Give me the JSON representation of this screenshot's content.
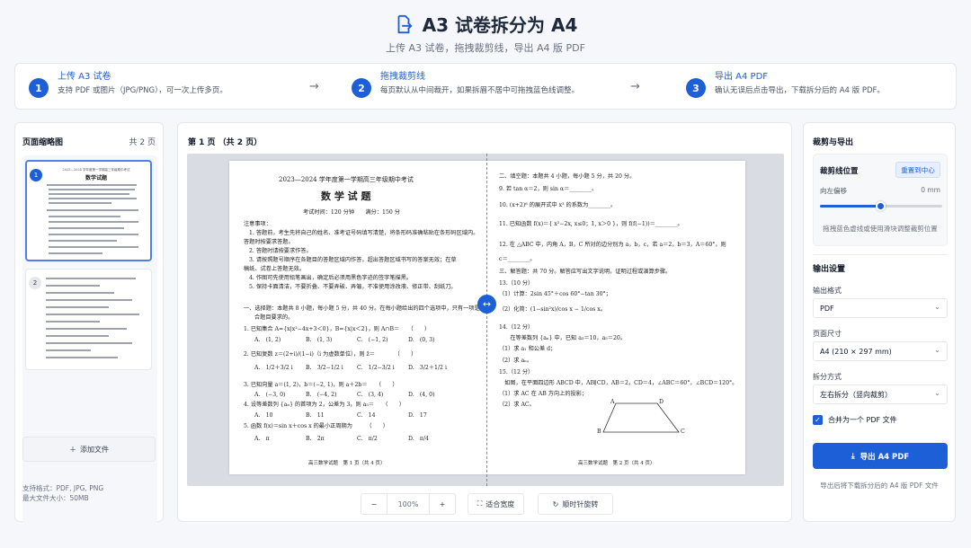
{
  "app": {
    "title": "A3 试卷拆分为 A4",
    "subtitle": "上传 A3 试卷，拖拽裁剪线，导出 A4 版 PDF",
    "icon": "file-export-icon",
    "accent": "#1d5fd6"
  },
  "steps": [
    {
      "num": "1",
      "title": "上传 A3 试卷",
      "desc": "支持 PDF 或图片（JPG/PNG），可一次上传多页。"
    },
    {
      "num": "2",
      "title": "拖拽裁剪线",
      "desc": "每页默认从中间裁开，如果拆眉不居中可拖拽蓝色线调整。"
    },
    {
      "num": "3",
      "title": "导出 A4 PDF",
      "desc": "确认无误后点击导出，下载拆分后的 A4 版 PDF。"
    }
  ],
  "left": {
    "header": "页面缩略图",
    "count": "共 2 页",
    "thumbs": [
      {
        "num": "1",
        "selected": true
      },
      {
        "num": "2",
        "selected": false
      }
    ],
    "add_label": "添加文件",
    "formats_line1": "支持格式：PDF, JPG, PNG",
    "formats_line2": "最大文件大小：50MB"
  },
  "center": {
    "page_info": "第 1 页 （共 2 页）",
    "zoom": "100%",
    "zoom_out": "−",
    "zoom_in": "+",
    "fit_width": "适合宽度",
    "rotate": "顺时针旋转"
  },
  "doc": {
    "left": {
      "heading": "2023—2024 学年度第一学期高三年级期中考试",
      "title": "数 学 试 题",
      "meta": "考试时间：120 分钟　　满分：150 分",
      "notes_title": "注意事项：",
      "notes": [
        "1. 答题前，考生先将自己的姓名、准考证号码填写清楚，将条形码准确粘贴在条形码区域内。",
        "答题时按要求答题。",
        "2. 答题时请按要求作答。",
        "3. 请按照题号顺序在各题目的答题区域内作答，超出答题区域书写的答案无效；在草",
        "稿纸、试卷上答题无效。",
        "4. 作图可先使用铅笔画出，确定后必须用黑色字迹的签字笔描黑。",
        "5. 保持卡面清洁，不要折叠、不要弄破、弄皱，不准使用涂改液、修正带、刮纸刀。"
      ],
      "section1": "一、选择题：本题共 8 小题，每小题 5 分，共 40 分。在每小题给出的四个选项中，只有一项是符",
      "section1b": "合题目要求的。",
      "q1": "1. 已知集合 A={x|x²−4x+3＜0}，B={x|x＜2}，则 A∩B＝　　（　　）",
      "q1_opts": [
        "A.　(1, 2)",
        "B.　(1, 3)",
        "C.　(−1, 2)",
        "D.　(0, 3)"
      ],
      "q2": "2. 已知复数 z＝(2+i)/(1−i)（i 为虚数单位），则 z̄＝　　　　（　　）",
      "q2_opts": [
        "A.　1/2＋3/2 i",
        "B.　3/2−1/2 i",
        "C.　1/2−3/2 i",
        "D.　3/2＋1/2 i"
      ],
      "q3": "3. 已知向量 a＝(1, 2)，b＝(−2, 1)，则 a＋2b＝　　（　　）",
      "q3_opts": [
        "A.　(−3, 0)",
        "B.　(−4, 2)",
        "C.　(3, 4)",
        "D.　(4, 0)"
      ],
      "q4": "4. 设等差数列 {aₙ} 的首项为 2，公差为 3，则 a₅＝　　（　　）",
      "q4_opts": [
        "A.　10",
        "B.　11",
        "C.　14",
        "D.　17"
      ],
      "q5": "5. 函数 f(x)＝sin x＋cos x 的最小正周期为　　　（　　）",
      "q5_opts": [
        "A.　π",
        "B.　2π",
        "C.　π/2",
        "D.　π/4"
      ],
      "footer": "高三数学试题　第 1 页（共 4 页）"
    },
    "right": {
      "section2": "二、填空题：本题共 4 小题，每小题 5 分，共 20 分。",
      "q9": "9. 若 tan α＝2，则 sin α＝________。",
      "q10": "10. (x+2)⁶ 的展开式中 x³ 的系数为________。",
      "q11": "11. 已知函数 f(x)＝{ x²−2x, x≤0；1, x＞0 }，则 f(f(−1))＝________。",
      "q12": "12. 在 △ABC 中，内角 A，B，C 所对的边分别为 a，b，c，若 a＝2，b＝3，A＝60°，则",
      "q12b": "c＝________。",
      "section3": "三、解答题：共 70 分。解答应写出文字说明，证明过程或演算步骤。",
      "q13": "13.（10 分）",
      "q13a": "（1）计算：2sin 45°＋cos 60°−tan 30°；",
      "q13b": "（2）化简：(1−sin²x)/cos x − 1/cos x。",
      "q14": "14.（12 分）",
      "q14a": "　　在等差数列 {aₙ} 中，已知 a₃＝10，a₅＝20。",
      "q14b": "（1）求 a₁ 和公差 d；",
      "q14c": "（2）求 aₙ。",
      "q15": "15.（12 分）",
      "q15a": "　如图，在平面四边形 ABCD 中，AB∥CD，AB＝2，CD＝4，∠ABC＝60°，∠BCD＝120°。",
      "q15b": "（1）求 AC 在 AB 方向上的投影；",
      "q15c": "（2）求 AC。",
      "labels": {
        "A": "A",
        "B": "B",
        "C": "C",
        "D": "D"
      },
      "footer": "高三数学试题　第 2 页（共 4 页）"
    }
  },
  "thumb_text": {
    "t1_title": "数学试题",
    "t1_head": "2023—2024 学年度第一学期高三年级期中考试"
  },
  "right": {
    "title": "裁剪与导出",
    "cut_title": "裁剪线位置",
    "recenter": "重置到中心",
    "offset_label": "向左偏移",
    "offset_value": "0 mm",
    "offset_fraction": 0.5,
    "cut_hint": "拖拽蓝色虚线或使用滑块调整裁剪位置",
    "output_title": "输出设置",
    "format_label": "输出格式",
    "format_value": "PDF",
    "size_label": "页面尺寸",
    "size_value": "A4 (210 × 297 mm)",
    "split_label": "拆分方式",
    "split_value": "左右拆分（竖向裁剪）",
    "merge_label": "合并为一个 PDF 文件",
    "export_label": "导出 A4 PDF",
    "export_hint": "导出后将下载拆分后的 A4 版 PDF 文件"
  }
}
